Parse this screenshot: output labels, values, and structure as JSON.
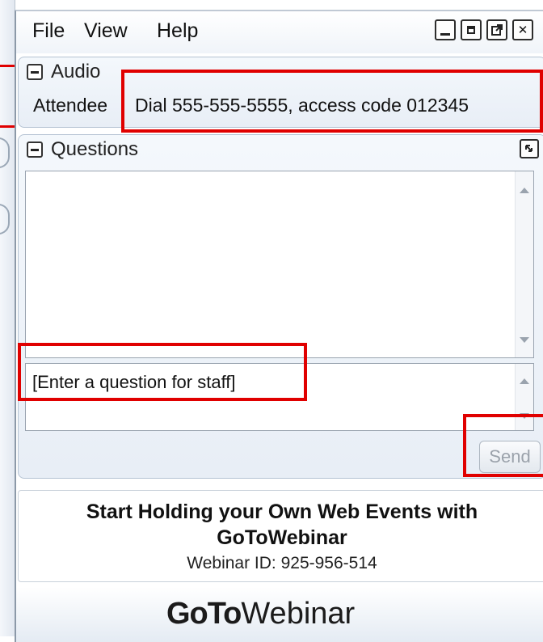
{
  "menu": {
    "file": "File",
    "view": "View",
    "help": "Help"
  },
  "audio": {
    "title": "Audio",
    "label": "Attendee",
    "info": "Dial 555-555-5555, access code 012345"
  },
  "questions": {
    "title": "Questions",
    "input_placeholder": "[Enter a question for staff]",
    "send_label": "Send"
  },
  "promo": {
    "line1": "Start Holding your Own Web Events with",
    "line2": "GoToWebinar",
    "webinar_id": "Webinar ID: 925-956-514"
  },
  "logo": {
    "bold": "GoTo",
    "light": "Webinar"
  },
  "colors": {
    "highlight": "#e00000",
    "panel_border": "#b5c3d3"
  }
}
